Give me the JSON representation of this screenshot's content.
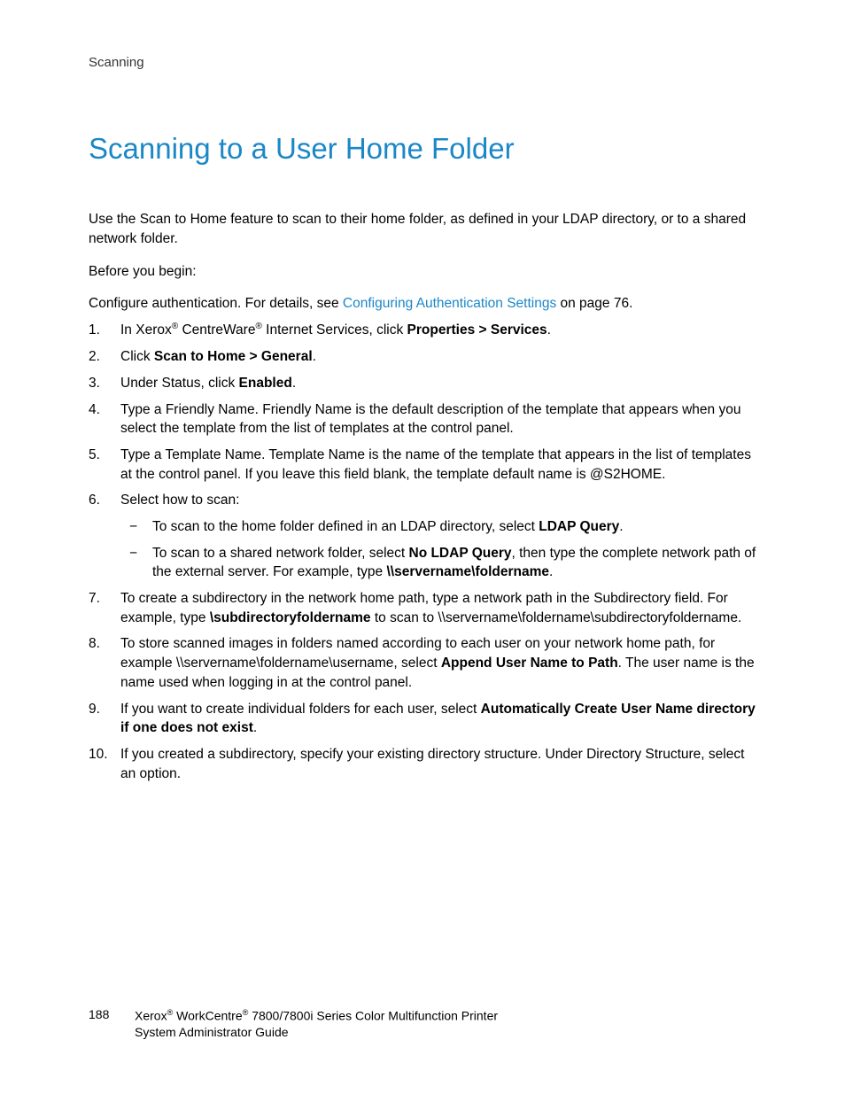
{
  "header": {
    "section": "Scanning"
  },
  "title": "Scanning to a User Home Folder",
  "intro": "Use the Scan to Home feature to scan to their home folder, as defined in your LDAP directory, or to a shared network folder.",
  "before": "Before you begin:",
  "configure": {
    "prefix": "Configure authentication. For details, see ",
    "link": "Configuring Authentication Settings",
    "suffix": " on page 76."
  },
  "steps": {
    "s1": {
      "prefix": "In Xerox",
      "reg1": "®",
      "mid1": " CentreWare",
      "reg2": "®",
      "mid2": " Internet Services, click ",
      "bold": "Properties > Services",
      "suffix": "."
    },
    "s2": {
      "prefix": "Click ",
      "bold": "Scan to Home > General",
      "suffix": "."
    },
    "s3": {
      "prefix": "Under Status, click ",
      "bold": "Enabled",
      "suffix": "."
    },
    "s4": "Type a Friendly Name. Friendly Name is the default description of the template that appears when you select the template from the list of templates at the control panel.",
    "s5": "Type a Template Name. Template Name is the name of the template that appears in the list of templates at the control panel. If you leave this field blank, the template default name is @S2HOME.",
    "s6": {
      "lead": "Select how to scan:",
      "a": {
        "prefix": "To scan to the home folder defined in an LDAP directory, select ",
        "bold": "LDAP Query",
        "suffix": "."
      },
      "b": {
        "prefix": "To scan to a shared network folder, select ",
        "bold1": "No LDAP Query",
        "mid": ", then type the complete network path of the external server. For example, type ",
        "bold2": "\\\\servername\\foldername",
        "suffix": "."
      }
    },
    "s7": {
      "prefix": "To create a subdirectory in the network home path, type a network path in the Subdirectory field. For example, type ",
      "bold": "\\subdirectoryfoldername",
      "suffix": " to scan to \\\\servername\\foldername\\subdirectoryfoldername."
    },
    "s8": {
      "prefix": "To store scanned images in folders named according to each user on your network home path, for example \\\\servername\\foldername\\username, select ",
      "bold": "Append User Name to Path",
      "suffix": ". The user name is the name used when logging in at the control panel."
    },
    "s9": {
      "prefix": "If you want to create individual folders for each user, select ",
      "bold": "Automatically Create User Name directory if one does not exist",
      "suffix": "."
    },
    "s10": "If you created a subdirectory, specify your existing directory structure. Under Directory Structure, select an option."
  },
  "footer": {
    "page": "188",
    "line1a": "Xerox",
    "reg1": "®",
    "line1b": " WorkCentre",
    "reg2": "®",
    "line1c": " 7800/7800i Series Color Multifunction Printer",
    "line2": "System Administrator Guide"
  }
}
